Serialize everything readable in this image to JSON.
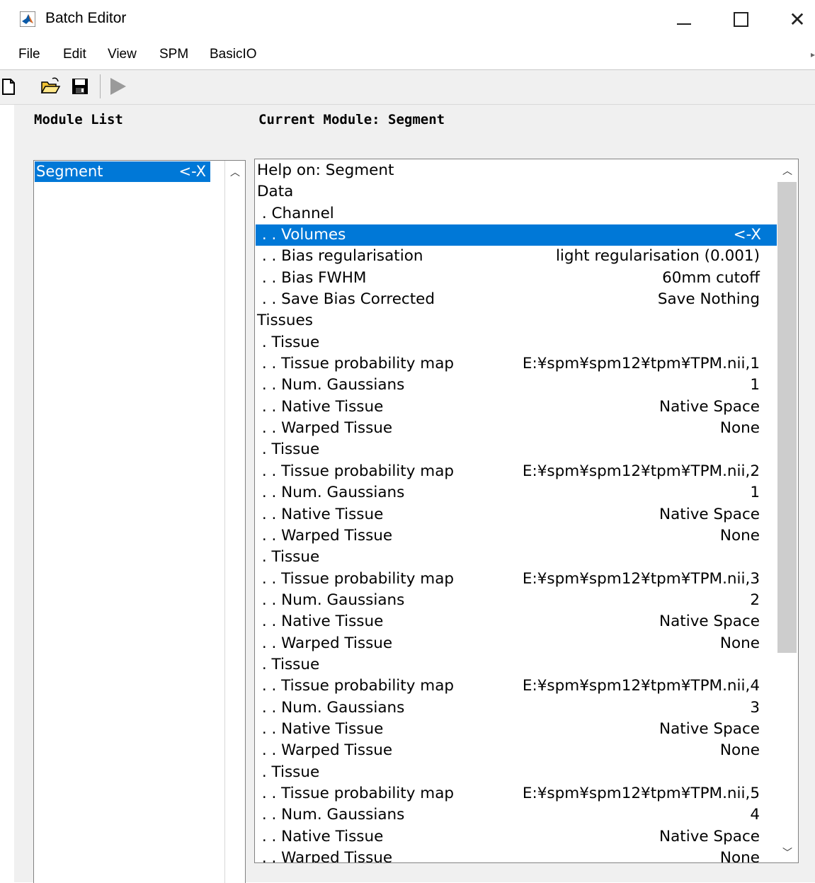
{
  "window": {
    "title": "Batch Editor",
    "icon": "matlab-logo-icon"
  },
  "menu": {
    "items": [
      "File",
      "Edit",
      "View",
      "SPM",
      "BasicIO"
    ]
  },
  "toolbar": {
    "icons": [
      "new-file-icon",
      "open-folder-icon",
      "save-icon",
      "run-icon"
    ]
  },
  "module_list": {
    "heading": "Module List",
    "items": [
      {
        "label": "Segment",
        "marker": "<-X",
        "selected": true
      }
    ]
  },
  "current_module": {
    "heading": "Current Module: Segment",
    "rows": [
      {
        "label": "Help on: Segment",
        "value": ""
      },
      {
        "label": "Data",
        "value": ""
      },
      {
        "label": " . Channel",
        "value": ""
      },
      {
        "label": " . . Volumes",
        "value": "<-X",
        "selected": true
      },
      {
        "label": " . . Bias regularisation",
        "value": "light regularisation (0.001)"
      },
      {
        "label": " . . Bias FWHM",
        "value": "60mm cutoff"
      },
      {
        "label": " . . Save Bias Corrected",
        "value": "Save Nothing"
      },
      {
        "label": "Tissues",
        "value": ""
      },
      {
        "label": " . Tissue",
        "value": ""
      },
      {
        "label": " . . Tissue probability map",
        "value": "E:¥spm¥spm12¥tpm¥TPM.nii,1"
      },
      {
        "label": " . . Num. Gaussians",
        "value": "1"
      },
      {
        "label": " . . Native Tissue",
        "value": "Native Space"
      },
      {
        "label": " . . Warped Tissue",
        "value": "None"
      },
      {
        "label": " . Tissue",
        "value": ""
      },
      {
        "label": " . . Tissue probability map",
        "value": "E:¥spm¥spm12¥tpm¥TPM.nii,2"
      },
      {
        "label": " . . Num. Gaussians",
        "value": "1"
      },
      {
        "label": " . . Native Tissue",
        "value": "Native Space"
      },
      {
        "label": " . . Warped Tissue",
        "value": "None"
      },
      {
        "label": " . Tissue",
        "value": ""
      },
      {
        "label": " . . Tissue probability map",
        "value": "E:¥spm¥spm12¥tpm¥TPM.nii,3"
      },
      {
        "label": " . . Num. Gaussians",
        "value": "2"
      },
      {
        "label": " . . Native Tissue",
        "value": "Native Space"
      },
      {
        "label": " . . Warped Tissue",
        "value": "None"
      },
      {
        "label": " . Tissue",
        "value": ""
      },
      {
        "label": " . . Tissue probability map",
        "value": "E:¥spm¥spm12¥tpm¥TPM.nii,4"
      },
      {
        "label": " . . Num. Gaussians",
        "value": "3"
      },
      {
        "label": " . . Native Tissue",
        "value": "Native Space"
      },
      {
        "label": " . . Warped Tissue",
        "value": "None"
      },
      {
        "label": " . Tissue",
        "value": ""
      },
      {
        "label": " . . Tissue probability map",
        "value": "E:¥spm¥spm12¥tpm¥TPM.nii,5"
      },
      {
        "label": " . . Num. Gaussians",
        "value": "4"
      },
      {
        "label": " . . Native Tissue",
        "value": "Native Space"
      },
      {
        "label": " . . Warped Tissue",
        "value": "None"
      }
    ]
  },
  "colors": {
    "selection": "#0078d7",
    "panel": "#f0f0f0",
    "scroll_thumb": "#cdcdcd"
  }
}
